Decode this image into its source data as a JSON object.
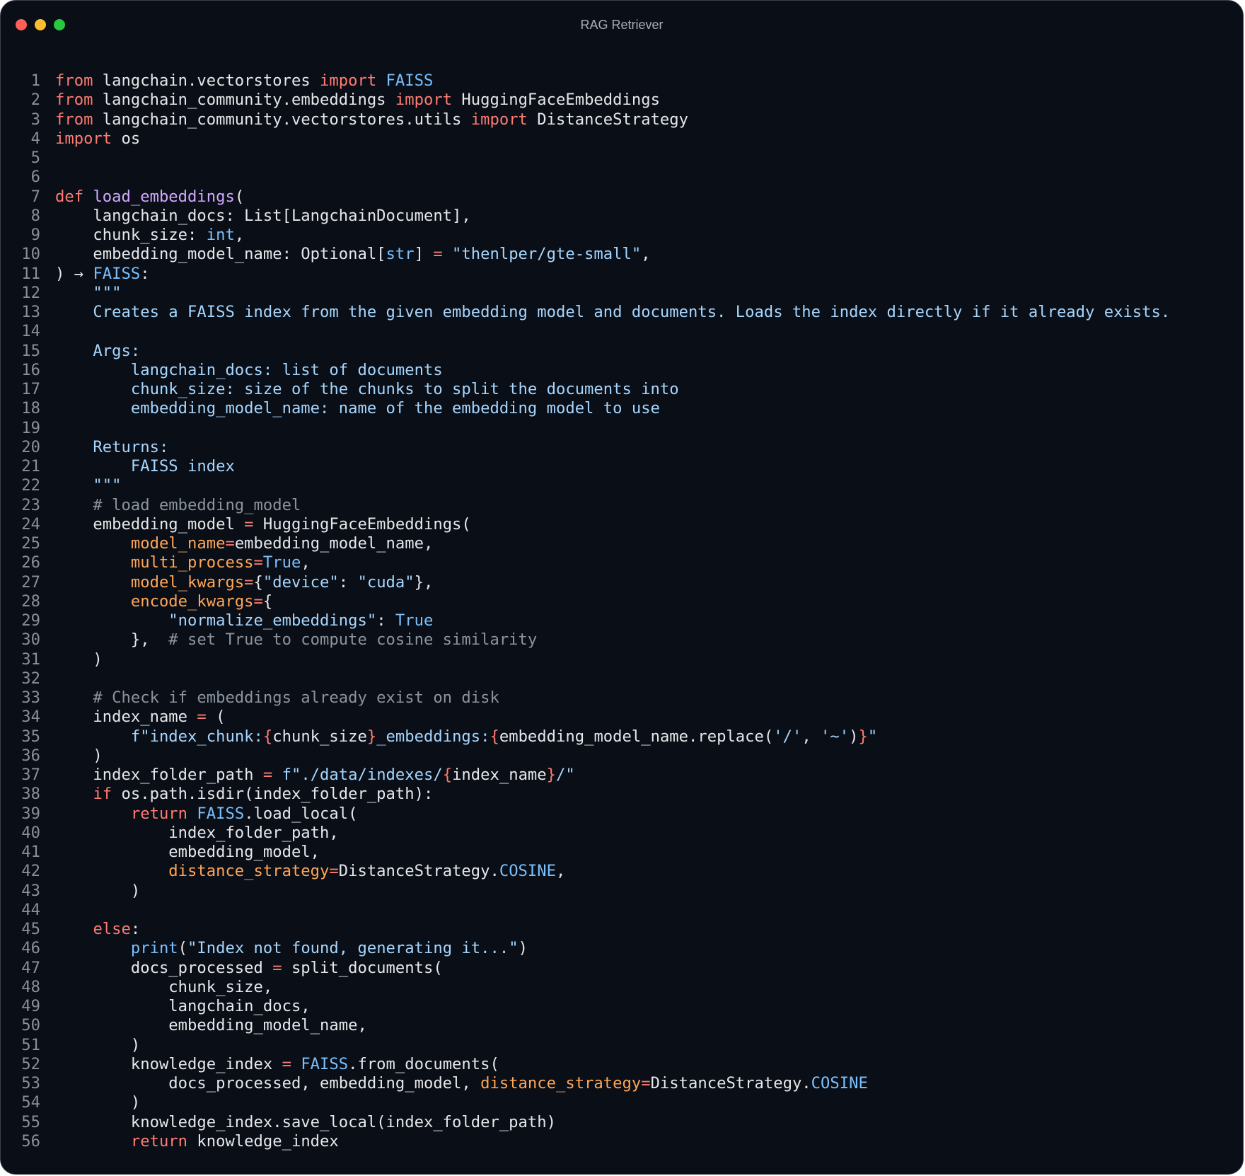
{
  "window": {
    "title": "RAG Retriever",
    "colors": {
      "background": "#0a0e16",
      "close": "#ff5f57",
      "minimize": "#febc2e",
      "maximize": "#28c840"
    }
  },
  "editor": {
    "language": "python",
    "lines": [
      {
        "n": "1",
        "t": [
          [
            "k",
            "from"
          ],
          [
            "p",
            " langchain.vectorstores "
          ],
          [
            "k",
            "import"
          ],
          [
            "p",
            " "
          ],
          [
            "b",
            "FAISS"
          ]
        ]
      },
      {
        "n": "2",
        "t": [
          [
            "k",
            "from"
          ],
          [
            "p",
            " langchain_community.embeddings "
          ],
          [
            "k",
            "import"
          ],
          [
            "p",
            " HuggingFaceEmbeddings"
          ]
        ]
      },
      {
        "n": "3",
        "t": [
          [
            "k",
            "from"
          ],
          [
            "p",
            " langchain_community.vectorstores.utils "
          ],
          [
            "k",
            "import"
          ],
          [
            "p",
            " DistanceStrategy"
          ]
        ]
      },
      {
        "n": "4",
        "t": [
          [
            "k",
            "import"
          ],
          [
            "p",
            " os"
          ]
        ]
      },
      {
        "n": "5",
        "t": []
      },
      {
        "n": "6",
        "t": []
      },
      {
        "n": "7",
        "t": [
          [
            "k",
            "def"
          ],
          [
            "p",
            " "
          ],
          [
            "f",
            "load_embeddings"
          ],
          [
            "p",
            "("
          ]
        ]
      },
      {
        "n": "8",
        "t": [
          [
            "p",
            "    langchain_docs: List[LangchainDocument],"
          ]
        ]
      },
      {
        "n": "9",
        "t": [
          [
            "p",
            "    chunk_size: "
          ],
          [
            "b",
            "int"
          ],
          [
            "p",
            ","
          ]
        ]
      },
      {
        "n": "10",
        "t": [
          [
            "p",
            "    embedding_model_name: Optional["
          ],
          [
            "b",
            "str"
          ],
          [
            "p",
            "] "
          ],
          [
            "o",
            "="
          ],
          [
            "p",
            " "
          ],
          [
            "s",
            "\"thenlper/gte-small\""
          ],
          [
            "p",
            ","
          ]
        ]
      },
      {
        "n": "11",
        "t": [
          [
            "p",
            ") → "
          ],
          [
            "b",
            "FAISS"
          ],
          [
            "p",
            ":"
          ]
        ]
      },
      {
        "n": "12",
        "t": [
          [
            "s",
            "    \"\"\""
          ]
        ]
      },
      {
        "n": "13",
        "t": [
          [
            "s",
            "    Creates a FAISS index from the given embedding model and documents. Loads the index directly if it already exists."
          ]
        ]
      },
      {
        "n": "14",
        "t": []
      },
      {
        "n": "15",
        "t": [
          [
            "s",
            "    Args:"
          ]
        ]
      },
      {
        "n": "16",
        "t": [
          [
            "s",
            "        langchain_docs: list of documents"
          ]
        ]
      },
      {
        "n": "17",
        "t": [
          [
            "s",
            "        chunk_size: size of the chunks to split the documents into"
          ]
        ]
      },
      {
        "n": "18",
        "t": [
          [
            "s",
            "        embedding_model_name: name of the embedding model to use"
          ]
        ]
      },
      {
        "n": "19",
        "t": []
      },
      {
        "n": "20",
        "t": [
          [
            "s",
            "    Returns:"
          ]
        ]
      },
      {
        "n": "21",
        "t": [
          [
            "s",
            "        FAISS index"
          ]
        ]
      },
      {
        "n": "22",
        "t": [
          [
            "s",
            "    \"\"\""
          ]
        ]
      },
      {
        "n": "23",
        "t": [
          [
            "c",
            "    # load embedding_model"
          ]
        ]
      },
      {
        "n": "24",
        "t": [
          [
            "p",
            "    embedding_model "
          ],
          [
            "o",
            "="
          ],
          [
            "p",
            " HuggingFaceEmbeddings("
          ]
        ]
      },
      {
        "n": "25",
        "t": [
          [
            "p",
            "        "
          ],
          [
            "a",
            "model_name"
          ],
          [
            "o",
            "="
          ],
          [
            "p",
            "embedding_model_name,"
          ]
        ]
      },
      {
        "n": "26",
        "t": [
          [
            "p",
            "        "
          ],
          [
            "a",
            "multi_process"
          ],
          [
            "o",
            "="
          ],
          [
            "b",
            "True"
          ],
          [
            "p",
            ","
          ]
        ]
      },
      {
        "n": "27",
        "t": [
          [
            "p",
            "        "
          ],
          [
            "a",
            "model_kwargs"
          ],
          [
            "o",
            "="
          ],
          [
            "p",
            "{"
          ],
          [
            "s",
            "\"device\""
          ],
          [
            "p",
            ": "
          ],
          [
            "s",
            "\"cuda\""
          ],
          [
            "p",
            "},"
          ]
        ]
      },
      {
        "n": "28",
        "t": [
          [
            "p",
            "        "
          ],
          [
            "a",
            "encode_kwargs"
          ],
          [
            "o",
            "="
          ],
          [
            "p",
            "{"
          ]
        ]
      },
      {
        "n": "29",
        "t": [
          [
            "p",
            "            "
          ],
          [
            "s",
            "\"normalize_embeddings\""
          ],
          [
            "p",
            ": "
          ],
          [
            "b",
            "True"
          ]
        ]
      },
      {
        "n": "30",
        "t": [
          [
            "p",
            "        },  "
          ],
          [
            "c",
            "# set True to compute cosine similarity"
          ]
        ]
      },
      {
        "n": "31",
        "t": [
          [
            "p",
            "    )"
          ]
        ]
      },
      {
        "n": "32",
        "t": []
      },
      {
        "n": "33",
        "t": [
          [
            "c",
            "    # Check if embeddings already exist on disk"
          ]
        ]
      },
      {
        "n": "34",
        "t": [
          [
            "p",
            "    index_name "
          ],
          [
            "o",
            "="
          ],
          [
            "p",
            " ("
          ]
        ]
      },
      {
        "n": "35",
        "t": [
          [
            "p",
            "        "
          ],
          [
            "s",
            "f\"index_chunk:"
          ],
          [
            "k",
            "{"
          ],
          [
            "p",
            "chunk_size"
          ],
          [
            "k",
            "}"
          ],
          [
            "s",
            "_embeddings:"
          ],
          [
            "k",
            "{"
          ],
          [
            "p",
            "embedding_model_name.replace("
          ],
          [
            "s",
            "'/'"
          ],
          [
            "p",
            ", "
          ],
          [
            "s",
            "'~'"
          ],
          [
            "p",
            ")"
          ],
          [
            "k",
            "}"
          ],
          [
            "s",
            "\""
          ]
        ]
      },
      {
        "n": "36",
        "t": [
          [
            "p",
            "    )"
          ]
        ]
      },
      {
        "n": "37",
        "t": [
          [
            "p",
            "    index_folder_path "
          ],
          [
            "o",
            "="
          ],
          [
            "p",
            " "
          ],
          [
            "s",
            "f\"./data/indexes/"
          ],
          [
            "k",
            "{"
          ],
          [
            "p",
            "index_name"
          ],
          [
            "k",
            "}"
          ],
          [
            "s",
            "/\""
          ]
        ]
      },
      {
        "n": "38",
        "t": [
          [
            "p",
            "    "
          ],
          [
            "k",
            "if"
          ],
          [
            "p",
            " os.path.isdir(index_folder_path):"
          ]
        ]
      },
      {
        "n": "39",
        "t": [
          [
            "p",
            "        "
          ],
          [
            "k",
            "return"
          ],
          [
            "p",
            " "
          ],
          [
            "b",
            "FAISS"
          ],
          [
            "p",
            ".load_local("
          ]
        ]
      },
      {
        "n": "40",
        "t": [
          [
            "p",
            "            index_folder_path,"
          ]
        ]
      },
      {
        "n": "41",
        "t": [
          [
            "p",
            "            embedding_model,"
          ]
        ]
      },
      {
        "n": "42",
        "t": [
          [
            "p",
            "            "
          ],
          [
            "a",
            "distance_strategy"
          ],
          [
            "o",
            "="
          ],
          [
            "p",
            "DistanceStrategy."
          ],
          [
            "b",
            "COSINE"
          ],
          [
            "p",
            ","
          ]
        ]
      },
      {
        "n": "43",
        "t": [
          [
            "p",
            "        )"
          ]
        ]
      },
      {
        "n": "44",
        "t": []
      },
      {
        "n": "45",
        "t": [
          [
            "p",
            "    "
          ],
          [
            "k",
            "else"
          ],
          [
            "p",
            ":"
          ]
        ]
      },
      {
        "n": "46",
        "t": [
          [
            "p",
            "        "
          ],
          [
            "b",
            "print"
          ],
          [
            "p",
            "("
          ],
          [
            "s",
            "\"Index not found, generating it...\""
          ],
          [
            "p",
            ")"
          ]
        ]
      },
      {
        "n": "47",
        "t": [
          [
            "p",
            "        docs_processed "
          ],
          [
            "o",
            "="
          ],
          [
            "p",
            " split_documents("
          ]
        ]
      },
      {
        "n": "48",
        "t": [
          [
            "p",
            "            chunk_size,"
          ]
        ]
      },
      {
        "n": "49",
        "t": [
          [
            "p",
            "            langchain_docs,"
          ]
        ]
      },
      {
        "n": "50",
        "t": [
          [
            "p",
            "            embedding_model_name,"
          ]
        ]
      },
      {
        "n": "51",
        "t": [
          [
            "p",
            "        )"
          ]
        ]
      },
      {
        "n": "52",
        "t": [
          [
            "p",
            "        knowledge_index "
          ],
          [
            "o",
            "="
          ],
          [
            "p",
            " "
          ],
          [
            "b",
            "FAISS"
          ],
          [
            "p",
            ".from_documents("
          ]
        ]
      },
      {
        "n": "53",
        "t": [
          [
            "p",
            "            docs_processed, embedding_model, "
          ],
          [
            "a",
            "distance_strategy"
          ],
          [
            "o",
            "="
          ],
          [
            "p",
            "DistanceStrategy."
          ],
          [
            "b",
            "COSINE"
          ]
        ]
      },
      {
        "n": "54",
        "t": [
          [
            "p",
            "        )"
          ]
        ]
      },
      {
        "n": "55",
        "t": [
          [
            "p",
            "        knowledge_index.save_local(index_folder_path)"
          ]
        ]
      },
      {
        "n": "56",
        "t": [
          [
            "p",
            "        "
          ],
          [
            "k",
            "return"
          ],
          [
            "p",
            " knowledge_index"
          ]
        ]
      }
    ]
  }
}
